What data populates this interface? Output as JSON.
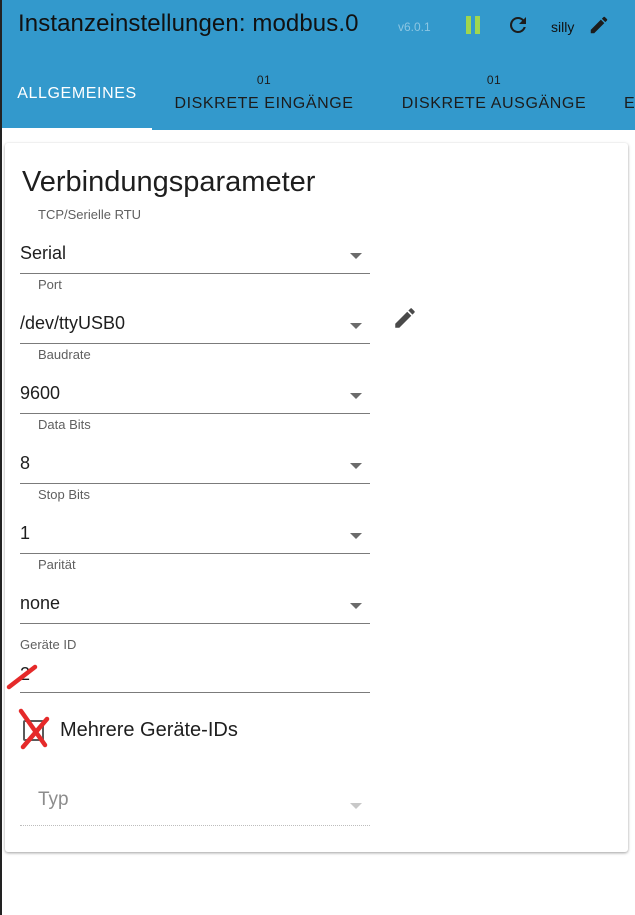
{
  "header": {
    "title": "Instanzeinstellungen: modbus.0",
    "version": "v6.0.1",
    "user": "silly",
    "icons": [
      "pause-icon",
      "refresh-icon",
      "edit-icon"
    ],
    "colors": {
      "bar": "#3399cc",
      "pause": "#9fd64f"
    }
  },
  "tabs": [
    {
      "count": "",
      "label": "ALLGEMEINES",
      "active": true
    },
    {
      "count": "01",
      "label": "DISKRETE EINGÄNGE"
    },
    {
      "count": "01",
      "label": "DISKRETE AUSGÄNGE"
    },
    {
      "count": "",
      "label": "E"
    }
  ],
  "main": {
    "section_title": "Verbindungsparameter",
    "fields": [
      {
        "label": "TCP/Serielle RTU",
        "value": "Serial",
        "type": "select"
      },
      {
        "label": "Port",
        "value": "/dev/ttyUSB0",
        "type": "select"
      },
      {
        "label": "Baudrate",
        "value": "9600",
        "type": "select"
      },
      {
        "label": "Data Bits",
        "value": "8",
        "type": "select"
      },
      {
        "label": "Stop Bits",
        "value": "1",
        "type": "select"
      },
      {
        "label": "Parität",
        "value": "none",
        "type": "select"
      },
      {
        "label": "Geräte ID",
        "value": "2",
        "type": "input"
      }
    ],
    "checkbox": {
      "label": "Mehrere Geräte-IDs",
      "checked": false
    },
    "typ": {
      "placeholder": "Typ"
    }
  }
}
